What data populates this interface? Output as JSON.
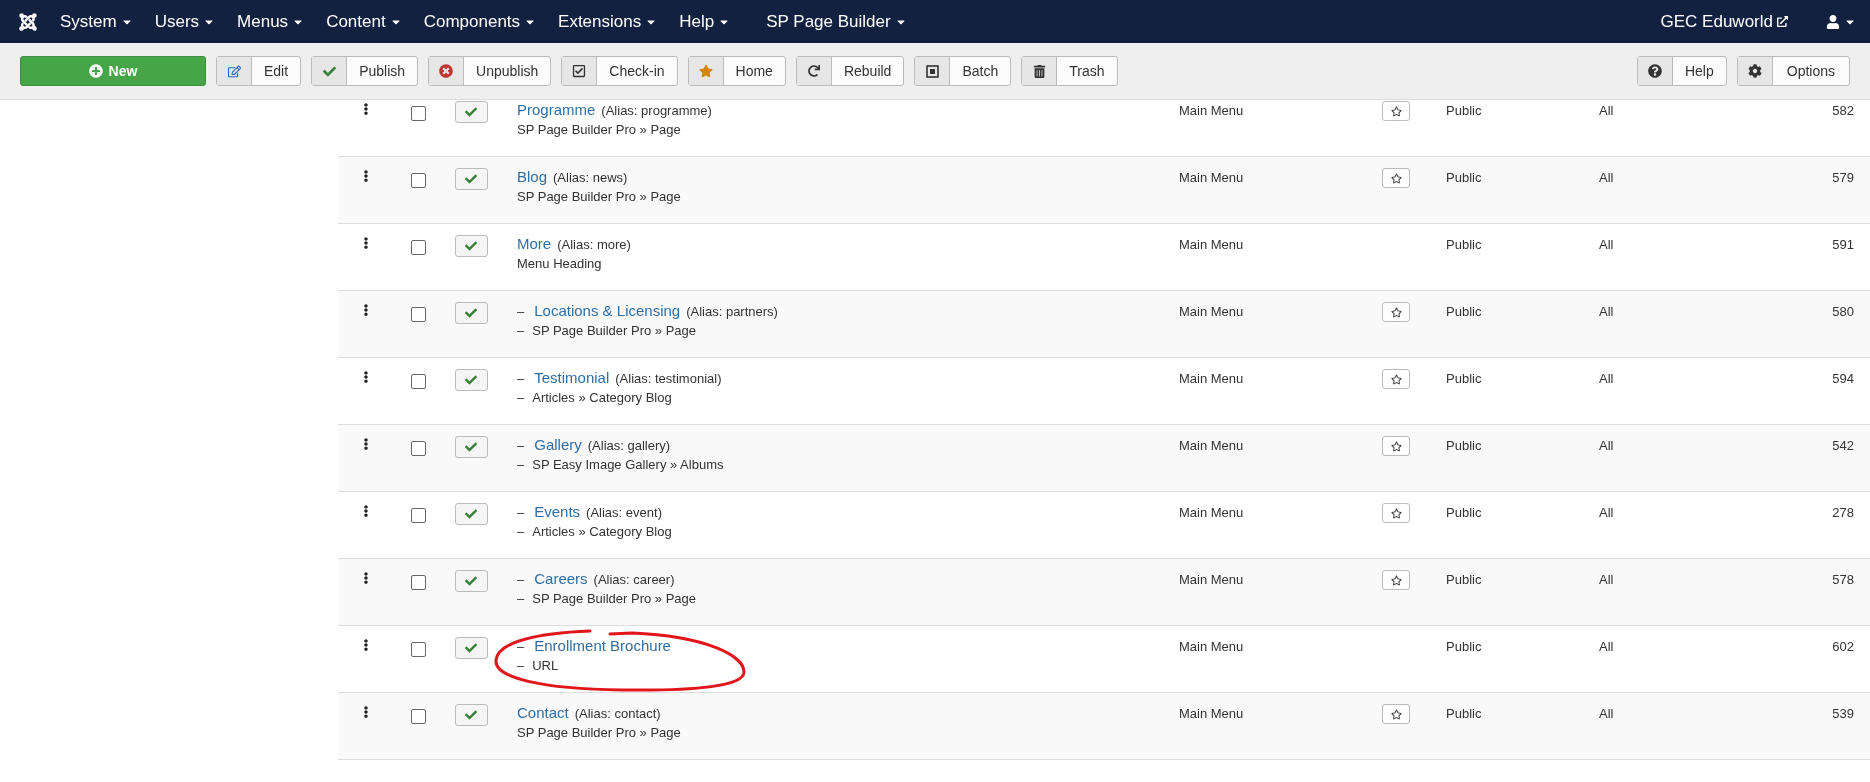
{
  "navbar": {
    "menus": [
      {
        "label": "System"
      },
      {
        "label": "Users"
      },
      {
        "label": "Menus"
      },
      {
        "label": "Content"
      },
      {
        "label": "Components"
      },
      {
        "label": "Extensions"
      },
      {
        "label": "Help"
      },
      {
        "label": "SP Page Builder"
      }
    ],
    "site_link": "GEC Eduworld"
  },
  "toolbar": {
    "buttons": [
      {
        "kind": "new",
        "label": "New"
      },
      {
        "kind": "edit",
        "label": "Edit"
      },
      {
        "kind": "publish",
        "label": "Publish"
      },
      {
        "kind": "unpublish",
        "label": "Unpublish"
      },
      {
        "kind": "checkin",
        "label": "Check-in"
      },
      {
        "kind": "home",
        "label": "Home"
      },
      {
        "kind": "rebuild",
        "label": "Rebuild"
      },
      {
        "kind": "batch",
        "label": "Batch"
      },
      {
        "kind": "trash",
        "label": "Trash"
      }
    ],
    "right_buttons": [
      {
        "kind": "help",
        "label": "Help"
      },
      {
        "kind": "options",
        "label": "Options"
      }
    ]
  },
  "menu_items": [
    {
      "title": "Programme",
      "alias": "(Alias: programme)",
      "type": "SP Page Builder Pro » Page",
      "menu": "Main Menu",
      "home_button": true,
      "access": "Public",
      "language": "All",
      "id": "582",
      "published": true,
      "checked": false
    },
    {
      "title": "Blog",
      "alias": "(Alias: news)",
      "type": "SP Page Builder Pro » Page",
      "menu": "Main Menu",
      "home_button": true,
      "access": "Public",
      "language": "All",
      "id": "579",
      "published": true,
      "checked": false
    },
    {
      "title": "More",
      "alias": "(Alias: more)",
      "type": "Menu Heading",
      "menu": "Main Menu",
      "home_button": false,
      "access": "Public",
      "language": "All",
      "id": "591",
      "published": true,
      "checked": false,
      "children": [
        {
          "prefix": "–",
          "title": "Locations & Licensing",
          "alias": "(Alias: partners)",
          "type_prefix": "–",
          "type": "SP Page Builder Pro » Page",
          "menu": "Main Menu",
          "home_button": true,
          "access": "Public",
          "language": "All",
          "id": "580",
          "published": true,
          "checked": false
        },
        {
          "prefix": "–",
          "title": "Testimonial",
          "alias": "(Alias: testimonial)",
          "type_prefix": "–",
          "type": "Articles » Category Blog",
          "menu": "Main Menu",
          "home_button": true,
          "access": "Public",
          "language": "All",
          "id": "594",
          "published": true,
          "checked": false
        },
        {
          "prefix": "–",
          "title": "Gallery",
          "alias": "(Alias: gallery)",
          "type_prefix": "–",
          "type": "SP Easy Image Gallery » Albums",
          "menu": "Main Menu",
          "home_button": true,
          "access": "Public",
          "language": "All",
          "id": "542",
          "published": true,
          "checked": false
        },
        {
          "prefix": "–",
          "title": "Events",
          "alias": "(Alias: event)",
          "type_prefix": "–",
          "type": "Articles » Category Blog",
          "menu": "Main Menu",
          "home_button": true,
          "access": "Public",
          "language": "All",
          "id": "278",
          "published": true,
          "checked": false
        },
        {
          "prefix": "–",
          "title": "Careers",
          "alias": "(Alias: career)",
          "type_prefix": "–",
          "type": "SP Page Builder Pro » Page",
          "menu": "Main Menu",
          "home_button": true,
          "access": "Public",
          "language": "All",
          "id": "578",
          "published": true,
          "checked": false
        },
        {
          "prefix": "–",
          "title": "Enrollment Brochure",
          "type_prefix": "–",
          "type": "URL",
          "menu": "Main Menu",
          "home_button": false,
          "access": "Public",
          "language": "All",
          "id": "602",
          "published": true,
          "checked": false,
          "highlighted": true
        }
      ]
    },
    {
      "title": "Contact",
      "alias": "(Alias: contact)",
      "type": "SP Page Builder Pro » Page",
      "menu": "Main Menu",
      "home_button": true,
      "access": "Public",
      "language": "All",
      "id": "539",
      "published": true,
      "checked": false
    }
  ]
}
